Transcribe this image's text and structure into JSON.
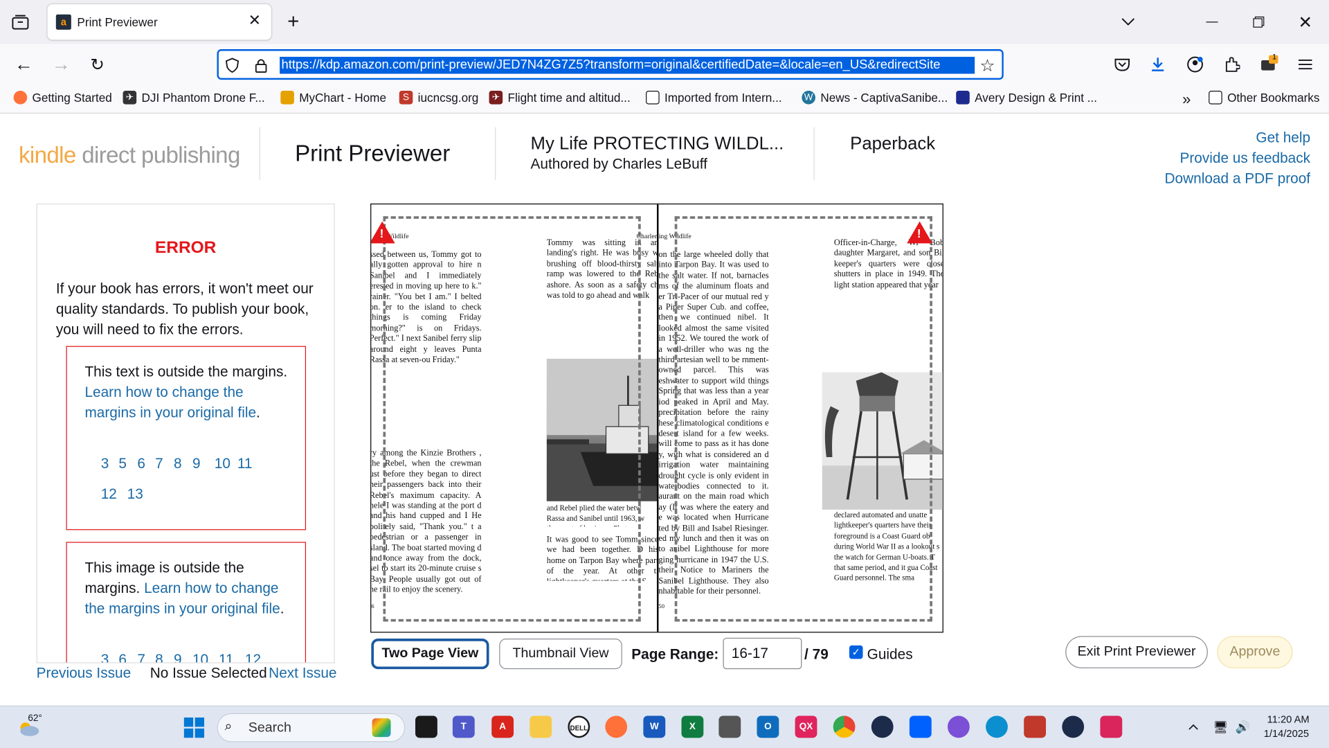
{
  "browser": {
    "tab_title": "Print Previewer",
    "url": "https://kdp.amazon.com/print-preview/JED7N4ZG7Z5?transform=original&certifiedDate=&locale=en_US&redirectSite",
    "bookmarks": [
      {
        "label": "Getting Started",
        "icon": "firefox-icon",
        "color": "#ff7139"
      },
      {
        "label": "DJI Phantom Drone F...",
        "icon": "dji-icon",
        "color": "#333333"
      },
      {
        "label": "MyChart - Home",
        "icon": "mychart-icon",
        "color": "#e5a100"
      },
      {
        "label": "iucncsg.org",
        "icon": "iucn-icon",
        "color": "#c0392b"
      },
      {
        "label": "Flight time and altitud...",
        "icon": "drone-icon",
        "color": "#7a1e1e"
      },
      {
        "label": "Imported from Intern...",
        "icon": "folder-icon",
        "color": "#ffffff"
      },
      {
        "label": "News - CaptivaSanibe...",
        "icon": "wordpress-icon",
        "color": "#21759b"
      },
      {
        "label": "Avery Design & Print ...",
        "icon": "avery-icon",
        "color": "#1d2b8f"
      },
      {
        "label": "Other Bookmarks",
        "icon": "folder-icon",
        "color": "#ffffff"
      }
    ],
    "extensions_badge": "1"
  },
  "header": {
    "logo_part1": "kindle",
    "logo_part2": " direct publishing",
    "page_title": "Print Previewer",
    "book_title": "My Life PROTECTING WILDL...",
    "author": "Authored by Charles LeBuff",
    "format": "Paperback",
    "links": [
      "Get help",
      "Provide us feedback",
      "Download a PDF proof"
    ]
  },
  "error_panel": {
    "title": "ERROR",
    "message": "If your book has errors, it won't meet our quality standards. To publish your book, you will need to fix the errors.",
    "issues": [
      {
        "text_prefix": "This text is outside the margins. ",
        "link": "Learn how to change the margins in your original file",
        "suffix": ".",
        "pages": [
          "3",
          "5",
          "6",
          "7",
          "8",
          "9",
          "10",
          "11",
          "12",
          "13"
        ]
      },
      {
        "text_prefix": "This image is outside the margins. ",
        "link": "Learn how to change the margins in your original file",
        "suffix": ".",
        "pages": [
          "3",
          "6",
          "7",
          "8",
          "9",
          "10",
          "11",
          "12"
        ]
      }
    ],
    "prev": "Previous Issue",
    "status": "No Issue Selected",
    "next": "Next Issue"
  },
  "viewer": {
    "left_header": "Wildlife",
    "right_header_a": "Charle",
    "right_header_b": "rting Wildlife",
    "left_col1": "ssed between us, Tommy got to ally gotten approval to hire n Sanibel and I immediately erested in moving up here to k.\" rainer. \"You bet I am.\" I belted on. er to the island to check things is coming Friday morning?\" is on Fridays. Perfect.\" I next Sanibel ferry slip around eight y leaves Punta Rassa at seven-ou Friday.\"",
    "left_col1b": "ry among the Kinzie Brothers , the Rebel, when the crewman ust before they began to direct heir passengers back into their Rebel's maximum capacity. A hele I was standing at the port d and his hand cupped and I He politely said, \"Thank you.\" t a pedestrian or a passenger in sland. The boat started moving d and once away from the dock, sel to start its 20-minute cruise s Bay. People usually got out of he rail to enjoy the scenery.",
    "left_col2": "Tommy was sitting in an landing's right. He was busy w brushing off blood-thirsty salt ramp was lowered to the Reb ashore. As soon as a safety ch was told to go ahead and walk",
    "left_caption": "and Rebel plied the water betw Rassa and Sanibel until 1963, w them out of business. Photograp",
    "left_col2b": "It was good to see Tomm since we had been together. D his home on Tarpon Bay where part of the year. At other ti lightkeeper's quarters at the S",
    "right_col1": "on the large wheeled dolly that into Tarpon Bay. It was used to the salt water. If not, barnacles ms of the aluminum floats and er Tri-Pacer of our mutual red y a Piper Super Cub. and coffee, then we continued nibel. It looked almost the same visited in 1952. We toured the work of a well-driller who was ng the third artesian well to be rnment-owned parcel. This was eshwater to support wild things Spring that was less than a year iod peaked in April and May. precipitation before the rainy hese climatological conditions e desert island for a few weeks. will come to pass as it has done y, with what is considered an d irrigation water maintaining drought cycle is only evident in waterbodies connected to it. aurant on the main road which ay (It was where the eatery and e was located when Hurricane ted by Bill and Isabel Riesinger. ed my lunch and then it was on to anibel Lighthouse for more ging hurricane in 1947 the U.S. their Notice to Mariners the Sanibel Lighthouse. They also nhabitable for their personnel.",
    "right_col2": "Officer-in-Charge, Wi Bob daughter Margaret, and son Bil keeper's quarters were close shutters in place in 1949. The light station appeared that year",
    "right_col2b": "declared automated and unatte lightkeeper's quarters have their foreground is a Coast Guard ob during World War II as a lookout s the watch for German U-boats. T that same period, and it gua Coast Guard personnel. The sma",
    "left_folio": "6",
    "right_folio": "50"
  },
  "controls": {
    "two_page": "Two Page View",
    "thumbnail": "Thumbnail View",
    "page_range_label": "Page Range:",
    "page_range_value": "16-17",
    "total_pages": "/ 79",
    "guides_label": "Guides",
    "guides_checked": true,
    "exit": "Exit Print Previewer",
    "approve": "Approve"
  },
  "taskbar": {
    "weather": "62°",
    "search": "Search",
    "time": "11:20 AM",
    "date": "1/14/2025",
    "apps": [
      {
        "name": "task-view-icon",
        "color": "#1a1a1a"
      },
      {
        "name": "teams-icon",
        "color": "#5059c9"
      },
      {
        "name": "acrobat-icon",
        "color": "#d9251c"
      },
      {
        "name": "file-explorer-icon",
        "color": "#f7c948"
      },
      {
        "name": "dell-icon",
        "color": "#1a1a1a"
      },
      {
        "name": "firefox-icon",
        "color": "#ff7139"
      },
      {
        "name": "word-icon",
        "color": "#185abd"
      },
      {
        "name": "excel-icon",
        "color": "#107c41"
      },
      {
        "name": "calculator-icon",
        "color": "#555555"
      },
      {
        "name": "outlook-icon",
        "color": "#0f6cbd"
      },
      {
        "name": "qx-icon",
        "color": "#e0245e"
      },
      {
        "name": "chrome-icon",
        "color": "#34a853"
      },
      {
        "name": "app-icon",
        "color": "#1c2b4a"
      },
      {
        "name": "dropbox-icon",
        "color": "#0061fe"
      },
      {
        "name": "circle-app-icon",
        "color": "#7b4fd6"
      },
      {
        "name": "edge-icon",
        "color": "#0c8fcf"
      },
      {
        "name": "affinity-icon",
        "color": "#c0392b"
      },
      {
        "name": "app2-icon",
        "color": "#1c2b4a"
      },
      {
        "name": "snipping-icon",
        "color": "#d9255c"
      }
    ]
  }
}
